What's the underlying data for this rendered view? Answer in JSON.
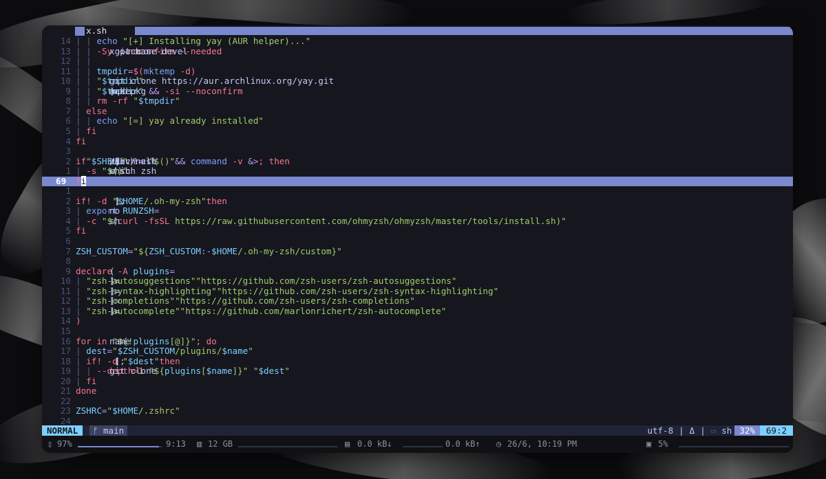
{
  "tab": {
    "filename": "x.sh"
  },
  "lines": [
    {
      "n": "14",
      "segs": [
        [
          "pipe",
          "| | "
        ],
        [
          "fn",
          "echo "
        ],
        [
          "str",
          "\"[+] Installing yay (AUR helper)...\""
        ]
      ]
    },
    {
      "n": "13",
      "segs": [
        [
          "pipe",
          "| | "
        ],
        [
          "code",
          "x pacman "
        ],
        [
          "kw",
          "-Sy --noconfirm --needed"
        ],
        [
          "code",
          " git base-devel"
        ]
      ]
    },
    {
      "n": "12",
      "segs": [
        [
          "pipe",
          "| |"
        ]
      ]
    },
    {
      "n": "11",
      "segs": [
        [
          "pipe",
          "| | "
        ],
        [
          "var",
          "tmpdir"
        ],
        [
          "op",
          "="
        ],
        [
          "kw",
          "$("
        ],
        [
          "fn",
          "mktemp"
        ],
        [
          "kw",
          " -d)"
        ]
      ]
    },
    {
      "n": "10",
      "segs": [
        [
          "pipe",
          "| | "
        ],
        [
          "code",
          "git clone https://aur.archlinux.org/yay.git "
        ],
        [
          "str",
          "\""
        ],
        [
          "var",
          "$tmpdir"
        ],
        [
          "str",
          "\""
        ]
      ]
    },
    {
      "n": "9",
      "segs": [
        [
          "pipe",
          "| | "
        ],
        [
          "code",
          "(cd "
        ],
        [
          "str",
          "\""
        ],
        [
          "var",
          "$tmpdir"
        ],
        [
          "str",
          "\""
        ],
        [
          "op",
          " && "
        ],
        [
          "code",
          "makepkg "
        ],
        [
          "kw",
          "-si --noconfirm"
        ],
        [
          "code",
          ")"
        ]
      ]
    },
    {
      "n": "8",
      "segs": [
        [
          "pipe",
          "| | "
        ],
        [
          "kw",
          "rm -rf "
        ],
        [
          "str",
          "\""
        ],
        [
          "var",
          "$tmpdir"
        ],
        [
          "str",
          "\""
        ]
      ]
    },
    {
      "n": "7",
      "segs": [
        [
          "pipe",
          "| "
        ],
        [
          "kw",
          "else"
        ]
      ]
    },
    {
      "n": "6",
      "segs": [
        [
          "pipe",
          "| | "
        ],
        [
          "fn",
          "echo "
        ],
        [
          "str",
          "\"[=] yay already installed\""
        ]
      ]
    },
    {
      "n": "5",
      "segs": [
        [
          "pipe",
          "| "
        ],
        [
          "kw",
          "fi"
        ]
      ]
    },
    {
      "n": "4",
      "segs": [
        [
          "kw",
          "fi"
        ]
      ]
    },
    {
      "n": "3",
      "segs": []
    },
    {
      "n": "2",
      "segs": [
        [
          "kw",
          "if"
        ],
        [
          "code",
          " [ "
        ],
        [
          "str",
          "\""
        ],
        [
          "var",
          "$SHELL"
        ],
        [
          "str",
          "\""
        ],
        [
          "op",
          " != "
        ],
        [
          "str",
          "\"$("
        ],
        [
          "code",
          "which zsh"
        ],
        [
          "str",
          ")\""
        ],
        [
          "code",
          " ] "
        ],
        [
          "op",
          "&& "
        ],
        [
          "fn",
          "command "
        ],
        [
          "kw",
          "-v "
        ],
        [
          "code",
          "zsh "
        ],
        [
          "op",
          "&>"
        ],
        [
          "code",
          "/dev/null"
        ],
        [
          "kw",
          "; then"
        ]
      ]
    },
    {
      "n": "1",
      "segs": [
        [
          "pipe",
          "| "
        ],
        [
          "code",
          "chsh "
        ],
        [
          "kw",
          "-s "
        ],
        [
          "str",
          "\"$("
        ],
        [
          "code",
          "which zsh"
        ],
        [
          "str",
          ")\""
        ]
      ]
    },
    {
      "n": "69",
      "current": true,
      "segs": [
        [
          "kw",
          "f"
        ],
        [
          "cursor",
          "i"
        ]
      ]
    },
    {
      "n": "1",
      "segs": []
    },
    {
      "n": "2",
      "segs": [
        [
          "kw",
          "if"
        ],
        [
          "code",
          " [ "
        ],
        [
          "kw",
          "! -d "
        ],
        [
          "str",
          "\""
        ],
        [
          "var",
          "$HOME"
        ],
        [
          "str",
          "/.oh-my-zsh\""
        ],
        [
          "code",
          " ]; "
        ],
        [
          "kw",
          "then"
        ]
      ]
    },
    {
      "n": "3",
      "segs": [
        [
          "pipe",
          "| "
        ],
        [
          "fn",
          "export "
        ],
        [
          "var",
          "RUNZSH"
        ],
        [
          "op",
          "="
        ],
        [
          "code",
          "no"
        ]
      ]
    },
    {
      "n": "4",
      "segs": [
        [
          "pipe",
          "| "
        ],
        [
          "code",
          "sh "
        ],
        [
          "kw",
          "-c "
        ],
        [
          "str",
          "\"$("
        ],
        [
          "kw",
          "curl -fsSL "
        ],
        [
          "str",
          "https://raw.githubusercontent.com/ohmyzsh/ohmyzsh/master/tools/install.sh)\""
        ]
      ]
    },
    {
      "n": "5",
      "segs": [
        [
          "kw",
          "fi"
        ]
      ]
    },
    {
      "n": "6",
      "segs": []
    },
    {
      "n": "7",
      "segs": [
        [
          "var",
          "ZSH_CUSTOM"
        ],
        [
          "op",
          "="
        ],
        [
          "str",
          "\"${"
        ],
        [
          "var",
          "ZSH_CUSTOM"
        ],
        [
          "op",
          ":-"
        ],
        [
          "var",
          "$HOME"
        ],
        [
          "str",
          "/.oh-my-zsh/custom}\""
        ]
      ]
    },
    {
      "n": "8",
      "segs": []
    },
    {
      "n": "9",
      "segs": [
        [
          "kw",
          "declare -A "
        ],
        [
          "var",
          "plugins"
        ],
        [
          "op",
          "="
        ],
        [
          "code",
          "("
        ]
      ]
    },
    {
      "n": "10",
      "segs": [
        [
          "pipe",
          "| "
        ],
        [
          "code",
          "["
        ],
        [
          "str",
          "\"zsh-autosuggestions\""
        ],
        [
          "code",
          "]="
        ],
        [
          "str",
          "\"https://github.com/zsh-users/zsh-autosuggestions\""
        ]
      ]
    },
    {
      "n": "11",
      "segs": [
        [
          "pipe",
          "| "
        ],
        [
          "code",
          "["
        ],
        [
          "str",
          "\"zsh-syntax-highlighting\""
        ],
        [
          "code",
          "]="
        ],
        [
          "str",
          "\"https://github.com/zsh-users/zsh-syntax-highlighting\""
        ]
      ]
    },
    {
      "n": "12",
      "segs": [
        [
          "pipe",
          "| "
        ],
        [
          "code",
          "["
        ],
        [
          "str",
          "\"zsh-completions\""
        ],
        [
          "code",
          "]="
        ],
        [
          "str",
          "\"https://github.com/zsh-users/zsh-completions\""
        ]
      ]
    },
    {
      "n": "13",
      "segs": [
        [
          "pipe",
          "| "
        ],
        [
          "code",
          "["
        ],
        [
          "str",
          "\"zsh-autocomplete\""
        ],
        [
          "code",
          "]="
        ],
        [
          "str",
          "\"https://github.com/marlonrichert/zsh-autocomplete\""
        ]
      ]
    },
    {
      "n": "14",
      "segs": [
        [
          "kw",
          ")"
        ]
      ]
    },
    {
      "n": "15",
      "segs": []
    },
    {
      "n": "16",
      "segs": [
        [
          "kw",
          "for "
        ],
        [
          "code",
          "name "
        ],
        [
          "kw",
          "in "
        ],
        [
          "str",
          "\"${!"
        ],
        [
          "var",
          "plugins"
        ],
        [
          "str",
          "[@]}\""
        ],
        [
          "kw",
          "; do"
        ]
      ]
    },
    {
      "n": "17",
      "segs": [
        [
          "pipe",
          "| "
        ],
        [
          "var",
          "dest"
        ],
        [
          "op",
          "="
        ],
        [
          "str",
          "\""
        ],
        [
          "var",
          "$ZSH_CUSTOM"
        ],
        [
          "str",
          "/plugins/"
        ],
        [
          "var",
          "$name"
        ],
        [
          "str",
          "\""
        ]
      ]
    },
    {
      "n": "18",
      "segs": [
        [
          "pipe",
          "| "
        ],
        [
          "kw",
          "if"
        ],
        [
          "code",
          " [ "
        ],
        [
          "kw",
          "! -d "
        ],
        [
          "str",
          "\""
        ],
        [
          "var",
          "$dest"
        ],
        [
          "str",
          "\""
        ],
        [
          "code",
          " ]; "
        ],
        [
          "kw",
          "then"
        ]
      ]
    },
    {
      "n": "19",
      "segs": [
        [
          "pipe",
          "| | "
        ],
        [
          "code",
          "git clone "
        ],
        [
          "kw",
          "--depth="
        ],
        [
          "num",
          "1"
        ],
        [
          "str",
          " \"${"
        ],
        [
          "var",
          "plugins"
        ],
        [
          "str",
          "["
        ],
        [
          "var",
          "$name"
        ],
        [
          "str",
          "]}\""
        ],
        [
          "str",
          " \""
        ],
        [
          "var",
          "$dest"
        ],
        [
          "str",
          "\""
        ]
      ]
    },
    {
      "n": "20",
      "segs": [
        [
          "pipe",
          "| "
        ],
        [
          "kw",
          "fi"
        ]
      ]
    },
    {
      "n": "21",
      "segs": [
        [
          "kw",
          "done"
        ]
      ]
    },
    {
      "n": "22",
      "segs": []
    },
    {
      "n": "23",
      "segs": [
        [
          "var",
          "ZSHRC"
        ],
        [
          "op",
          "="
        ],
        [
          "str",
          "\""
        ],
        [
          "var",
          "$HOME"
        ],
        [
          "str",
          "/.zshrc\""
        ]
      ]
    },
    {
      "n": "24",
      "segs": []
    }
  ],
  "status": {
    "mode": "NORMAL",
    "branch": "ᚠ main",
    "encoding": "utf-8",
    "sep1": "|",
    "os_icon": "Δ",
    "sep2": "|",
    "filetype_icon": "▭",
    "filetype": "sh",
    "percent": "32%",
    "position": "69:2"
  },
  "bar": {
    "battery_icon": "battery-icon",
    "battery": "97%",
    "battery_level": 0.97,
    "time": "9:13",
    "ram_icon": "memory-icon",
    "ram": "12 GB",
    "net_icon": "network-icon",
    "download": "0.0 kB↓",
    "upload": "0.0 kB↑",
    "clock_icon": "clock-icon",
    "datetime": "26/6, 10:19 PM",
    "cpu_icon": "cpu-icon",
    "cpu": "5%"
  }
}
